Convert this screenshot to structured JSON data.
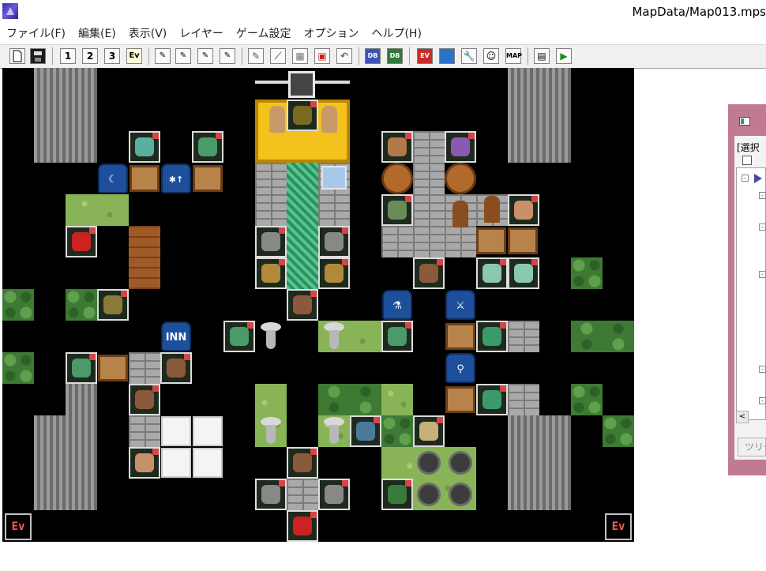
{
  "window": {
    "title": "MapData/Map013.mps"
  },
  "menu": {
    "items": [
      {
        "label": "ファイル(F)"
      },
      {
        "label": "編集(E)"
      },
      {
        "label": "表示(V)"
      },
      {
        "label": "レイヤー"
      },
      {
        "label": "ゲーム設定"
      },
      {
        "label": "オプション"
      },
      {
        "label": "ヘルプ(H)"
      }
    ]
  },
  "toolbar": {
    "layer1": "1",
    "layer2": "2",
    "layer3": "3",
    "event_layer": "Ev"
  },
  "map": {
    "signs": {
      "inn": "INN"
    },
    "ev_markers": {
      "bottom_left": "Ev",
      "bottom_right": "Ev"
    }
  },
  "side_panel": {
    "label": "[選択",
    "tree_button": "ツリー"
  }
}
